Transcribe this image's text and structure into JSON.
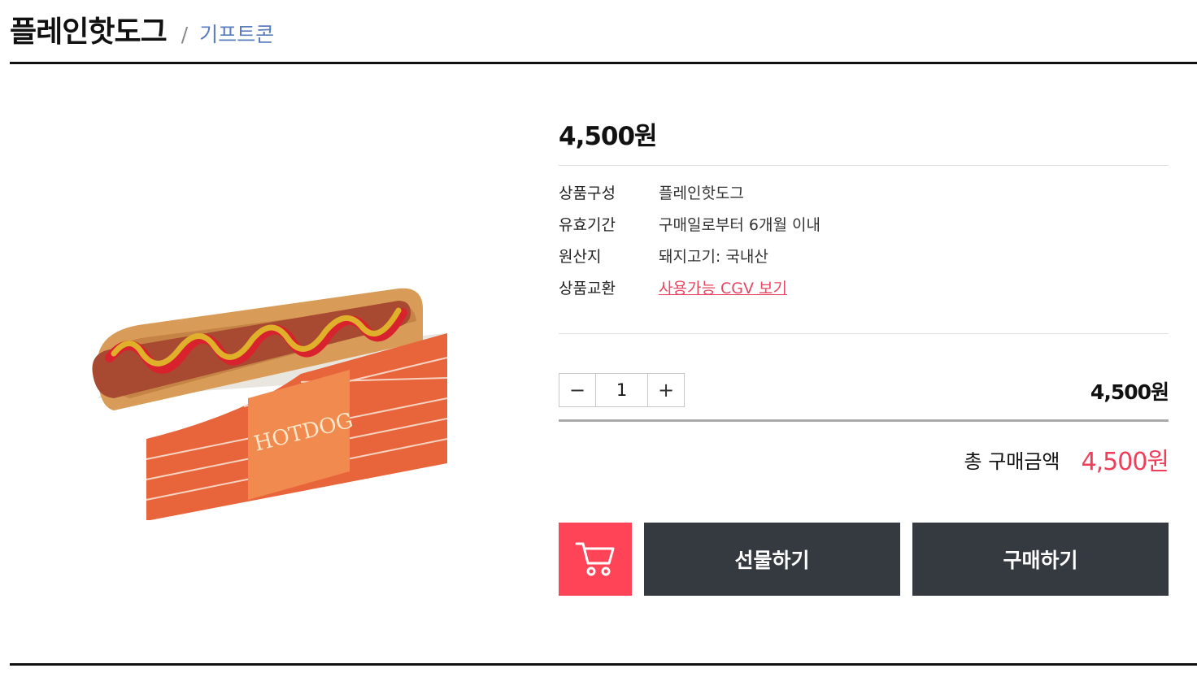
{
  "header": {
    "title": "플레인핫도그",
    "slash": "/",
    "category": "기프트콘"
  },
  "product": {
    "image_icon": "hotdog-product-image",
    "price": "4,500원",
    "specs": [
      {
        "label": "상품구성",
        "value": "플레인핫도그"
      },
      {
        "label": "유효기간",
        "value": "구매일로부터 6개월 이내"
      },
      {
        "label": "원산지",
        "value": "돼지고기: 국내산"
      },
      {
        "label": "상품교환",
        "value": "사용가능 CGV 보기"
      }
    ]
  },
  "quantity": {
    "minus": "−",
    "value": "1",
    "plus": "+",
    "line_price": "4,500원"
  },
  "total": {
    "label": "총 구매금액",
    "price": "4,500원"
  },
  "actions": {
    "cart_icon": "cart-icon",
    "gift_label": "선물하기",
    "buy_label": "구매하기"
  },
  "colors": {
    "accent": "#ef3e5a",
    "cart_bg": "#ff4458",
    "button_dark": "#353a40",
    "category": "#5a7dbd"
  }
}
